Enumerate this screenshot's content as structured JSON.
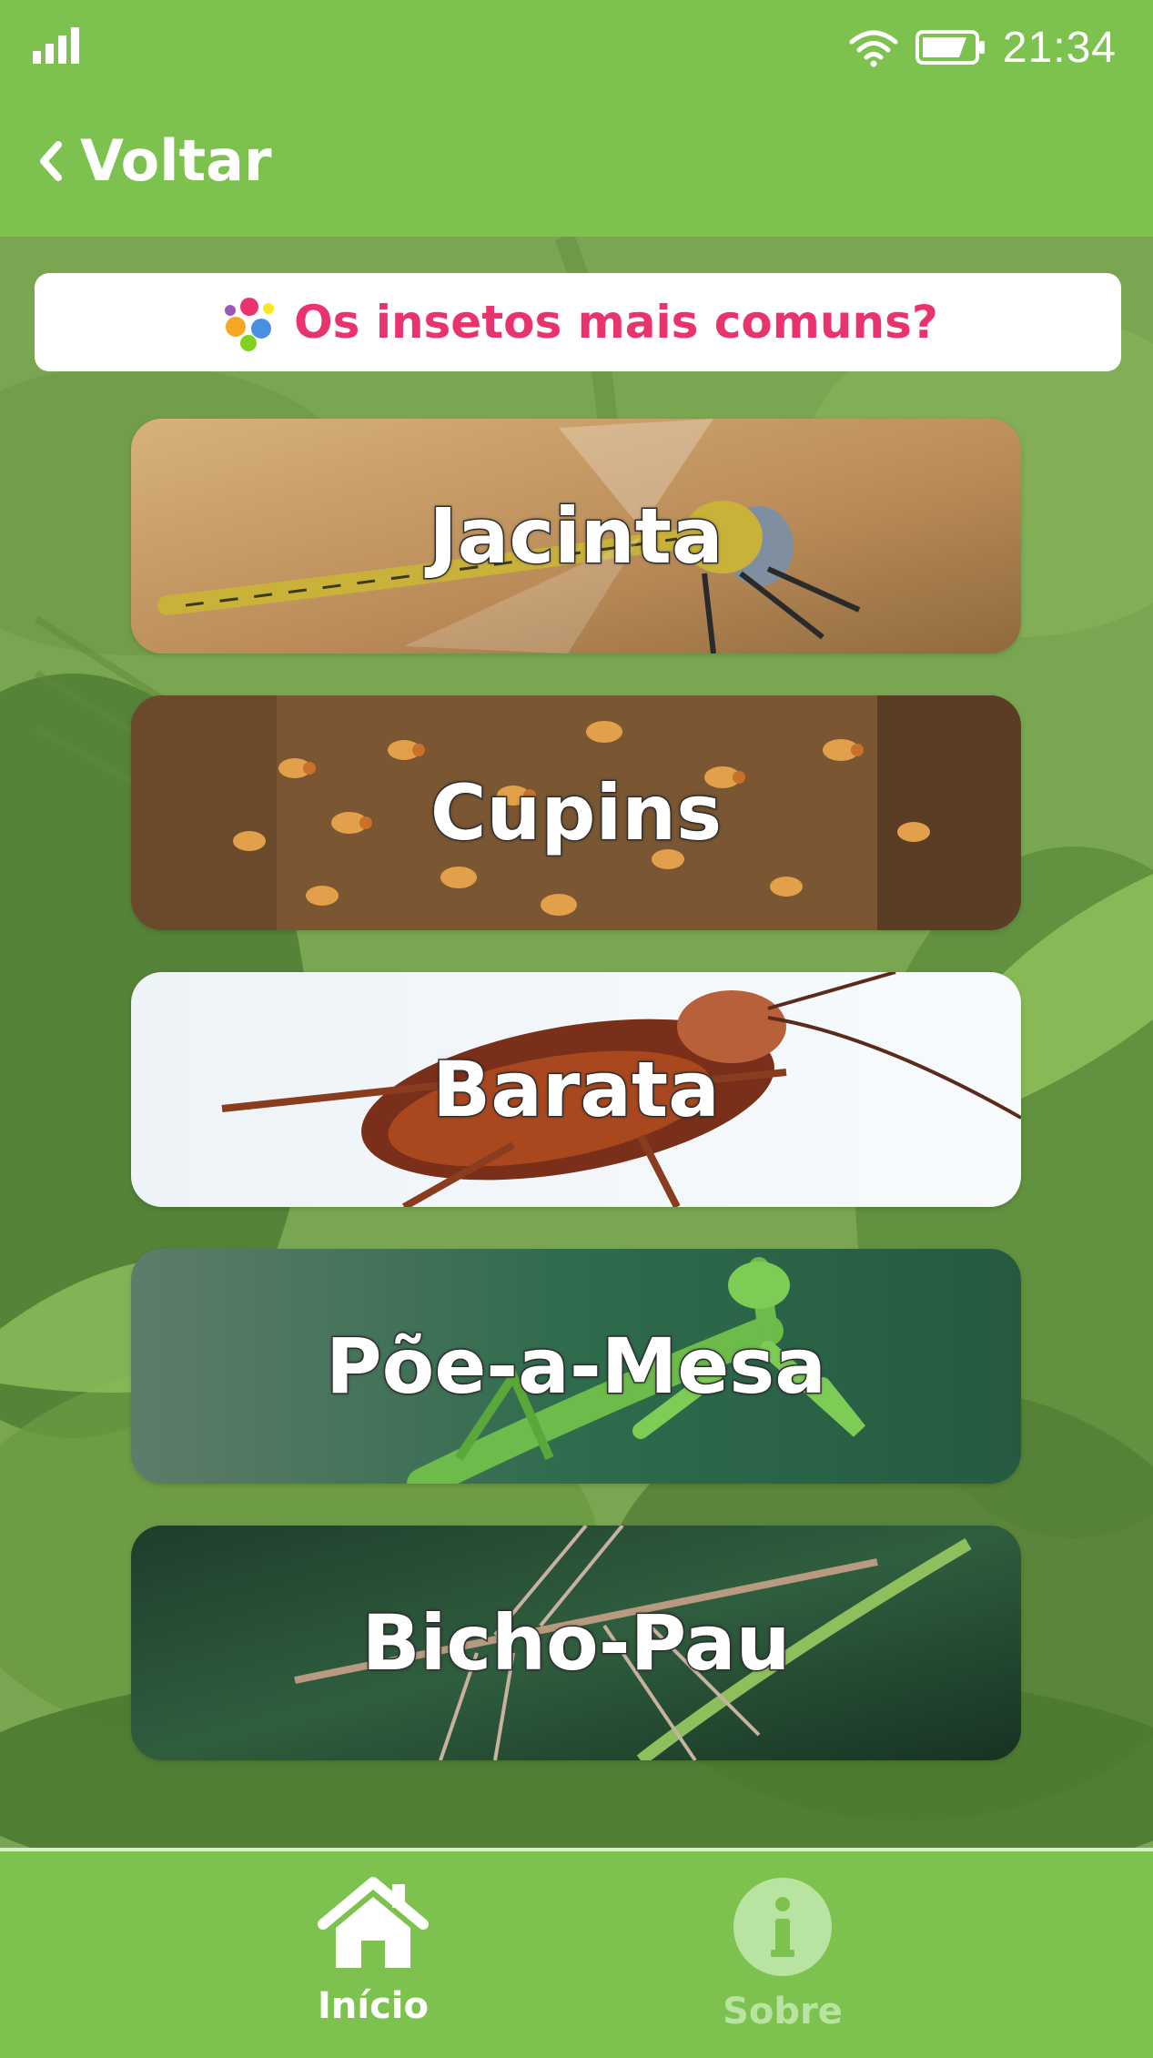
{
  "status_bar": {
    "time": "21:34",
    "icons": [
      "signal-icon",
      "wifi-icon",
      "battery-icon"
    ]
  },
  "top_bar": {
    "back_label": "Voltar",
    "back_icon": "chevron-left-icon"
  },
  "header": {
    "title": "Os insetos mais comuns?",
    "icon": "insects-icon"
  },
  "insects": [
    {
      "name": "Jacinta"
    },
    {
      "name": "Cupins"
    },
    {
      "name": "Barata"
    },
    {
      "name": "Põe-a-Mesa"
    },
    {
      "name": "Bicho-Pau"
    }
  ],
  "tab_bar": {
    "tabs": [
      {
        "label": "Início",
        "icon": "home-icon",
        "active": true
      },
      {
        "label": "Sobre",
        "icon": "info-icon",
        "active": false
      }
    ]
  },
  "colors": {
    "app_green": "#7dc24f",
    "header_title": "#e8336d",
    "tab_active": "#ffffff",
    "tab_inactive": "#b9e3a0"
  }
}
